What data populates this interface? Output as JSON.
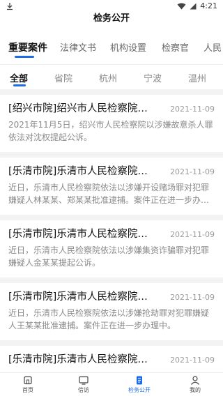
{
  "status": {
    "time": "4:21"
  },
  "header": {
    "title": "检务公开"
  },
  "tabs": [
    {
      "label": "重要案件",
      "active": true
    },
    {
      "label": "法律文书"
    },
    {
      "label": "机构设置"
    },
    {
      "label": "检察官"
    },
    {
      "label": "人民"
    }
  ],
  "subtabs": [
    {
      "label": "全部",
      "active": true
    },
    {
      "label": "省院"
    },
    {
      "label": "杭州"
    },
    {
      "label": "宁波"
    },
    {
      "label": "温州"
    }
  ],
  "items": [
    {
      "title": "[绍兴市院]绍兴市人民检察院依法对…",
      "date": "2021-11-09",
      "summary": "2021年11月5日，绍兴市人民检察院以涉嫌故意杀人罪依法对沈权提起公诉。"
    },
    {
      "title": "[乐清市院]乐清市人民检察院依法对…",
      "date": "2021-11-09",
      "summary": "近日，乐清市人民检察院依法以涉嫌开设赌场罪对犯罪嫌疑人林某某、郑某某批准逮捕。案件正在进一步办理中。"
    },
    {
      "title": "[乐清市院]乐清市人民检察院依法对…",
      "date": "2021-11-09",
      "summary": "近日，乐清市人民检察院依法以涉嫌集资诈骗罪对犯罪嫌疑人金某某提起公诉。"
    },
    {
      "title": "[乐清市院]乐清市人民检察院依法对…",
      "date": "2021-11-09",
      "summary": "近日，乐清市人民检察院依法以涉嫌抢劫罪对犯罪嫌疑人王某某批准逮捕。案件正在进一步办理中。"
    },
    {
      "title": "[乐清市院]乐清市人民检察院依法对…",
      "date": "2021-11-09",
      "summary": ""
    }
  ],
  "nav": [
    {
      "label": "首页",
      "icon": "home-icon"
    },
    {
      "label": "信访",
      "icon": "tv-icon"
    },
    {
      "label": "检务公开",
      "icon": "document-icon",
      "active": true
    },
    {
      "label": "我的",
      "icon": "user-icon"
    }
  ],
  "colors": {
    "accent": "#1e6ce8"
  }
}
